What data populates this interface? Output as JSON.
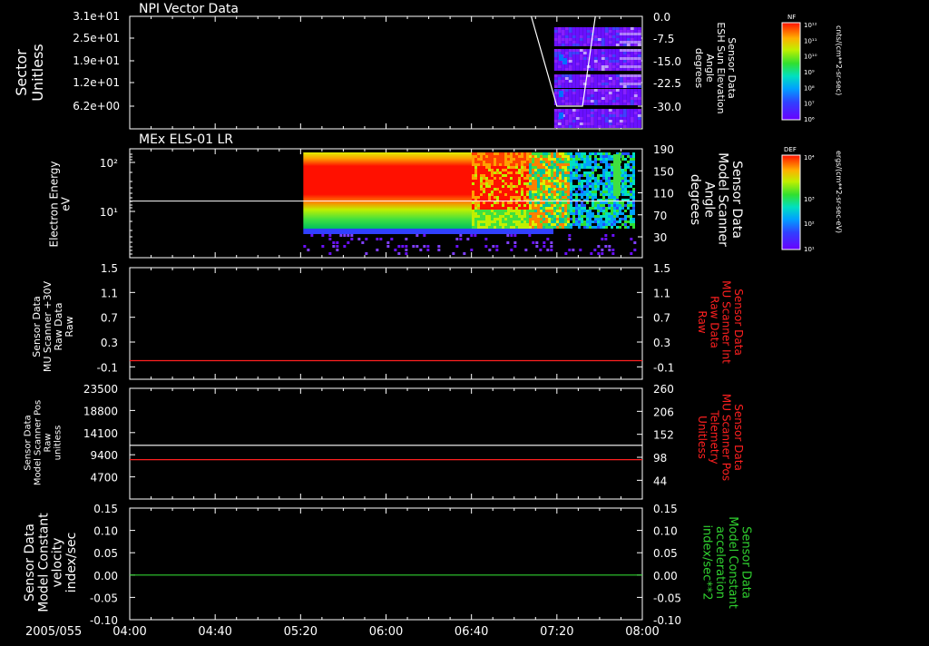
{
  "date_label": "2005/055",
  "time_ticks": [
    "04:00",
    "04:40",
    "05:20",
    "06:00",
    "06:40",
    "07:20",
    "08:00"
  ],
  "colorbars": [
    {
      "title": "NF",
      "unit": "cnts/(cm**2-sr-sec)",
      "tick_labels": [
        "10¹²",
        "10¹¹",
        "10¹⁰",
        "10⁹",
        "10⁸",
        "10⁷",
        "10⁶"
      ]
    },
    {
      "title": "DEF",
      "unit": "ergs/(cm**2-sr-sec-eV)",
      "tick_labels": [
        "10⁴",
        "10³",
        "10²",
        "10¹"
      ]
    }
  ],
  "chart_data": [
    {
      "type": "heatmap",
      "title": "NPI Vector Data",
      "ylabel_left": [
        "Sector",
        "Unitless"
      ],
      "ylabel_right": [
        "Sensor Data",
        "ESH Sun Elevation",
        "Angle",
        "degrees"
      ],
      "left_ticks": [
        "3.1e+01",
        "2.5e+01",
        "1.9e+01",
        "1.2e+01",
        "6.2e+00"
      ],
      "right_ticks": [
        "0.0",
        "-7.5",
        "-15.0",
        "-22.5",
        "-30.0"
      ],
      "x_range": [
        "04:00",
        "08:00"
      ],
      "data_extent": [
        "07:20",
        "08:00"
      ],
      "line_series": {
        "name": "",
        "x": [
          "07:08",
          "07:20",
          "07:26",
          "07:32",
          "07:38"
        ],
        "y": [
          0.0,
          -30.0,
          -30.0,
          -30.0,
          0.0
        ]
      }
    },
    {
      "type": "heatmap",
      "title": "MEx ELS-01 LR",
      "ylabel_left": [
        "Electron Energy",
        "eV"
      ],
      "ylabel_right": [
        "Sensor Data",
        "Model Scanner",
        "Angle",
        "degrees"
      ],
      "left_ticks": [
        "10²",
        "10¹"
      ],
      "right_ticks": [
        "190",
        "150",
        "110",
        "70",
        "30"
      ],
      "x_range": [
        "04:00",
        "08:00"
      ],
      "data_extent": [
        "05:20",
        "08:00"
      ],
      "line_series": {
        "name": "",
        "x": [
          "04:00",
          "08:00"
        ],
        "y": [
          95,
          95
        ]
      }
    },
    {
      "type": "line",
      "ylabel_left": [
        "Sensor Data",
        "MU Scanner +30V",
        "Raw Data",
        "Raw"
      ],
      "ylabel_right": [
        "Sensor Data",
        "MU Scanner Int",
        "Raw Data",
        "Raw"
      ],
      "left_ticks": [
        "1.5",
        "1.1",
        "0.7",
        "0.3",
        "-0.1"
      ],
      "right_ticks": [
        "1.5",
        "1.1",
        "0.7",
        "0.3",
        "-0.1"
      ],
      "ylim": [
        -0.3,
        1.5
      ],
      "series": [
        {
          "name": "",
          "color": "#ff2020",
          "x": [
            "04:00",
            "08:00"
          ],
          "y": [
            0.0,
            0.0
          ]
        }
      ]
    },
    {
      "type": "line",
      "ylabel_left": [
        "Sensor Data",
        "Model Scanner Pos",
        "Raw",
        "unitless"
      ],
      "ylabel_right": [
        "Sensor Data",
        "MU Scanner Pos",
        "Telemetry",
        "Unitless"
      ],
      "left_ticks": [
        "23500",
        "18800",
        "14100",
        "9400",
        "4700"
      ],
      "right_ticks": [
        "260",
        "206",
        "152",
        "98",
        "44"
      ],
      "ylim_left": [
        0,
        23500
      ],
      "ylim_right": [
        0,
        260
      ],
      "series": [
        {
          "name": "",
          "color": "#ffffff",
          "x": [
            "04:00",
            "08:00"
          ],
          "y": [
            11400,
            11400
          ]
        },
        {
          "name": "",
          "color": "#ff2020",
          "x": [
            "04:00",
            "08:00"
          ],
          "y": [
            8350,
            8350
          ]
        }
      ]
    },
    {
      "type": "line",
      "ylabel_left": [
        "Sensor Data",
        "Model Constant",
        "velocity",
        "index/sec"
      ],
      "ylabel_right": [
        "Sensor Data",
        "Model Constant",
        "acceleration",
        "index/sec**2"
      ],
      "left_ticks": [
        "0.15",
        "0.10",
        "0.05",
        "0.00",
        "-0.05",
        "-0.10"
      ],
      "right_ticks": [
        "0.15",
        "0.10",
        "0.05",
        "0.00",
        "-0.05",
        "-0.10"
      ],
      "ylim": [
        -0.1,
        0.15
      ],
      "series": [
        {
          "name": "",
          "color": "#30d030",
          "x": [
            "04:00",
            "08:00"
          ],
          "y": [
            0.0,
            0.0
          ]
        }
      ]
    }
  ]
}
